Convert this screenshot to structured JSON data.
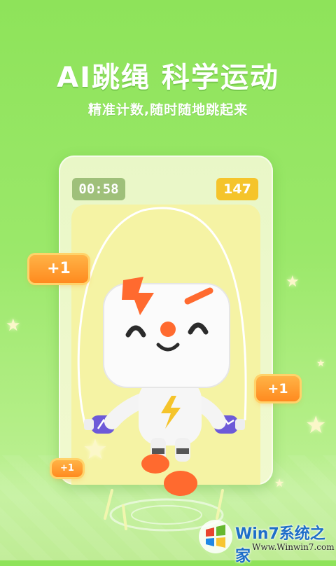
{
  "hero": {
    "title": "AI跳绳 科学运动",
    "subtitle": "精准计数,随时随地跳起来"
  },
  "phone": {
    "timer": "00:58",
    "count": "147"
  },
  "bonuses": {
    "plus_large": "+1",
    "plus_right": "+1",
    "plus_small": "+1"
  },
  "watermark": {
    "brand": "Win7系统之家",
    "url": "Www.Winwin7.com"
  },
  "colors": {
    "background": "#8ee35a",
    "count_badge": "#f5c42b",
    "timer_badge": "#9fc07a",
    "bonus": "#ff9a2a"
  },
  "icons": {
    "mascot": "cube-robot-mascot",
    "stars": "sparkle-star-icon"
  }
}
